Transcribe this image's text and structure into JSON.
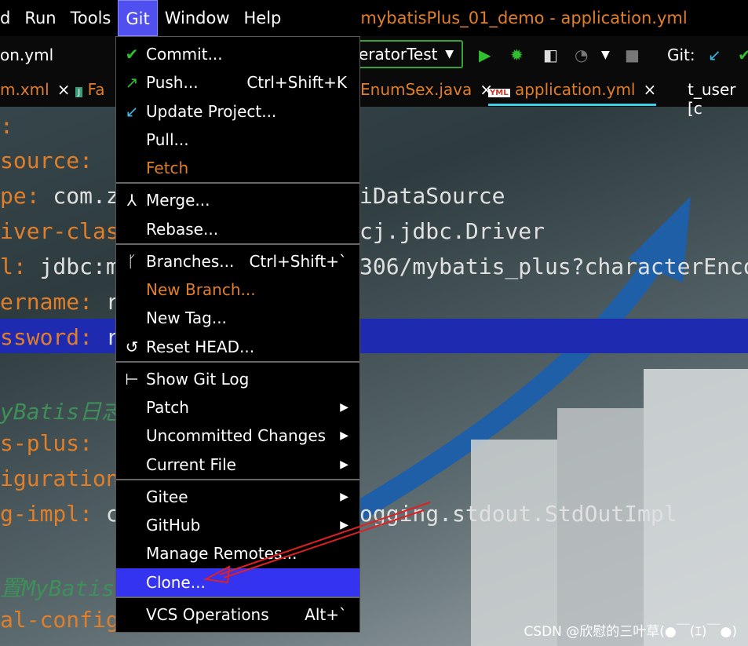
{
  "menubar": {
    "items": [
      "d",
      "Run",
      "Tools",
      "Git",
      "Window",
      "Help"
    ],
    "title": "mybatisPlus_01_demo - application.yml"
  },
  "toolbar": {
    "file": "on.yml",
    "run_config": "eratorTest",
    "git_label": "Git:"
  },
  "tabs": [
    {
      "label": "m.xml",
      "close": "×"
    },
    {
      "label": "Fa",
      "close": ""
    },
    {
      "label": "EnumSex.java",
      "close": "×"
    },
    {
      "label": "application.yml",
      "close": "×"
    },
    {
      "label": "t_user [c",
      "close": ""
    }
  ],
  "editor": {
    "lines": [
      {
        "key": ":",
        "rest": ""
      },
      {
        "key": "source:",
        "rest": ""
      },
      {
        "key": "pe:",
        "rest": " com.z"
      },
      {
        "key": "iver-clas",
        "rest": ""
      },
      {
        "key": "l:",
        "rest": " jdbc:m"
      },
      {
        "key": "ername:",
        "rest": " r"
      },
      {
        "key": "ssword:",
        "rest": " r"
      },
      {
        "key": "",
        "rest": ""
      },
      {
        "comment": "yBatis日志"
      },
      {
        "key": "s-plus:",
        "rest": ""
      },
      {
        "key": "iguration",
        "rest": ""
      },
      {
        "key": "g-impl:",
        "rest": " c"
      },
      {
        "key": "",
        "rest": ""
      },
      {
        "comment": "置MyBatis-"
      },
      {
        "key": "al-config",
        "rest": ""
      }
    ],
    "right_fragments": [
      "iDataSource",
      "cj.jdbc.Driver",
      "306/mybatis_plus?characterEnco",
      "ogging.stdout.StdOutImpl"
    ]
  },
  "menu": {
    "items": [
      {
        "label": "Commit...",
        "icon": "check-icon",
        "glyph": "✔",
        "color": "#2fbf2f"
      },
      {
        "label": "Push...",
        "shortcut": "Ctrl+Shift+K",
        "icon": "push-arrow-icon",
        "glyph": "↗",
        "color": "#2fbf2f"
      },
      {
        "label": "Update Project...",
        "icon": "update-arrow-icon",
        "glyph": "↙",
        "color": "#3bb8e8"
      },
      {
        "label": "Pull..."
      },
      {
        "label": "Fetch",
        "orange": true
      },
      {
        "label": "Merge...",
        "icon": "merge-icon",
        "glyph": "⅄",
        "color": "#ffffff"
      },
      {
        "label": "Rebase..."
      },
      {
        "label": "Branches...",
        "shortcut": "Ctrl+Shift+`",
        "icon": "branch-icon",
        "glyph": "ᚴ",
        "color": "#ffffff"
      },
      {
        "label": "New Branch...",
        "orange": true
      },
      {
        "label": "New Tag..."
      },
      {
        "label": "Reset HEAD...",
        "icon": "undo-icon",
        "glyph": "↺",
        "color": "#ffffff"
      },
      {
        "label": "Show Git Log",
        "icon": "git-log-icon",
        "glyph": "⊢",
        "color": "#ffffff"
      },
      {
        "label": "Patch",
        "submenu": true
      },
      {
        "label": "Uncommitted Changes",
        "submenu": true
      },
      {
        "label": "Current File",
        "submenu": true
      },
      {
        "label": "Gitee",
        "submenu": true
      },
      {
        "label": "GitHub",
        "submenu": true
      },
      {
        "label": "Manage Remotes..."
      },
      {
        "label": "Clone...",
        "selected": true
      },
      {
        "label": "VCS Operations",
        "shortcut": "Alt+`"
      }
    ],
    "submenu_glyph": "▶"
  },
  "watermark": "CSDN @欣慰的三叶草(●￣(ｴ)￣●)",
  "colors": {
    "accent": "#3434f0",
    "orange": "#e07e2a",
    "green": "#2fbf2f",
    "highlight_line": "#1e2bb0"
  }
}
